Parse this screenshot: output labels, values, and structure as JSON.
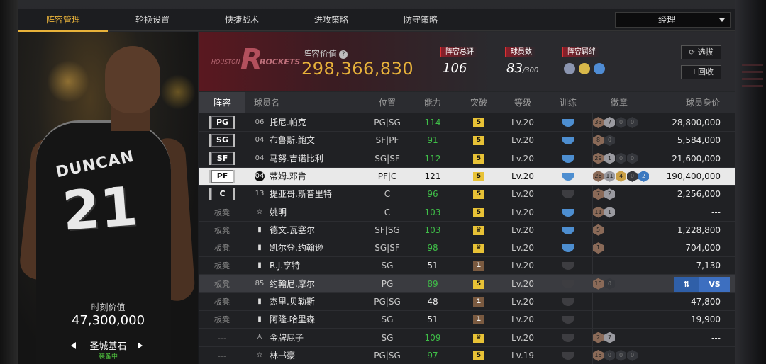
{
  "tabs": [
    "阵容管理",
    "轮换设置",
    "快捷战术",
    "进攻策略",
    "防守策略"
  ],
  "dropdown": {
    "value": "经理"
  },
  "portrait": {
    "jersey_name": "DUNCAN",
    "jersey_number": "21",
    "value_label": "时刻价值",
    "value": "47,300,000",
    "skin": "圣城基石",
    "status": "装备中"
  },
  "summary": {
    "team_logo": {
      "left_text": "HOUSTON",
      "right_text": "ROCKETS",
      "mark": "R"
    },
    "lineup_value_label": "阵容价值",
    "lineup_value": "298,366,830",
    "rating_label": "阵容总评",
    "rating": "106",
    "players_label": "球员数",
    "players": "83",
    "players_max": "/300",
    "bond_label": "阵容羁绊",
    "btn_select": "选拔",
    "btn_recycle": "回收"
  },
  "headers": [
    "阵容",
    "球员名",
    "位置",
    "能力",
    "突破",
    "等级",
    "训练",
    "徽章",
    "球员身价"
  ],
  "swap": {
    "a": "⇅",
    "b": "VS"
  },
  "rows": [
    {
      "slot": "PG",
      "num": "06",
      "name": "托尼.帕克",
      "pos": "PG|SG",
      "ability": "114",
      "ab_green": true,
      "brk": "5",
      "brk_y": true,
      "level": "Lv.20",
      "train": "blue",
      "badges": [
        [
          "br",
          "33"
        ],
        [
          "sl",
          "7"
        ],
        [
          "dk",
          "0"
        ],
        [
          "dk",
          "0"
        ]
      ],
      "salary": "28,800,000"
    },
    {
      "slot": "SG",
      "num": "04",
      "name": "布鲁斯.鲍文",
      "pos": "SF|PF",
      "ability": "91",
      "ab_green": true,
      "brk": "5",
      "brk_y": true,
      "level": "Lv.20",
      "train": "blue",
      "badges": [
        [
          "br",
          "8"
        ],
        [
          "dk",
          "0"
        ]
      ],
      "salary": "5,584,000"
    },
    {
      "slot": "SF",
      "num": "04",
      "name": "马努.吉诺比利",
      "pos": "SG|SF",
      "ability": "112",
      "ab_green": true,
      "brk": "5",
      "brk_y": true,
      "level": "Lv.20",
      "train": "blue",
      "badges": [
        [
          "br",
          "29"
        ],
        [
          "sl",
          "1"
        ],
        [
          "dk",
          "0"
        ],
        [
          "dk",
          "0"
        ]
      ],
      "salary": "21,600,000"
    },
    {
      "slot": "PF",
      "num": "04",
      "name": "蒂姆.邓肯",
      "pos": "PF|C",
      "ability": "121",
      "ab_green": false,
      "brk": "5",
      "brk_y": true,
      "level": "Lv.20",
      "train": "blue",
      "badges": [
        [
          "br",
          "26"
        ],
        [
          "sl",
          "11"
        ],
        [
          "gd",
          "4"
        ],
        [
          "dk",
          "0"
        ],
        [
          "bl",
          "2"
        ]
      ],
      "salary": "190,400,000",
      "sel": true
    },
    {
      "slot": "C",
      "num": "13",
      "name": "提亚哥.斯普里特",
      "pos": "C",
      "ability": "96",
      "ab_green": true,
      "brk": "5",
      "brk_y": true,
      "level": "Lv.20",
      "train": "gray",
      "badges": [
        [
          "br",
          "7"
        ],
        [
          "sl",
          "2"
        ]
      ],
      "salary": "2,256,000"
    },
    {
      "slot": "板凳",
      "num": "☆",
      "name": "姚明",
      "pos": "C",
      "ability": "103",
      "ab_green": true,
      "brk": "5",
      "brk_y": true,
      "level": "Lv.20",
      "train": "blue",
      "badges": [
        [
          "br",
          "11"
        ],
        [
          "sl",
          "1"
        ]
      ],
      "salary": "---"
    },
    {
      "slot": "板凳",
      "num": "▮",
      "name": "德文.瓦塞尔",
      "pos": "SF|SG",
      "ability": "103",
      "ab_green": true,
      "brk": "♛",
      "brk_y": true,
      "level": "Lv.20",
      "train": "blue",
      "badges": [
        [
          "br",
          "5"
        ]
      ],
      "salary": "1,228,800"
    },
    {
      "slot": "板凳",
      "num": "▮",
      "name": "凯尔登.约翰逊",
      "pos": "SG|SF",
      "ability": "98",
      "ab_green": true,
      "brk": "♛",
      "brk_y": true,
      "level": "Lv.20",
      "train": "blue",
      "badges": [
        [
          "br",
          "1"
        ]
      ],
      "salary": "704,000"
    },
    {
      "slot": "板凳",
      "num": "▮",
      "name": "R.J.亨特",
      "pos": "SG",
      "ability": "51",
      "ab_green": false,
      "brk": "1",
      "brk_y": false,
      "level": "Lv.20",
      "train": "gray",
      "badges": [],
      "salary": "7,130"
    },
    {
      "slot": "板凳",
      "num": "85",
      "name": "约翰尼.摩尔",
      "pos": "PG",
      "ability": "89",
      "ab_green": true,
      "brk": "5",
      "brk_y": true,
      "level": "Lv.20",
      "train": "gray",
      "badges": [
        [
          "br",
          "15"
        ],
        [
          "dk",
          "0"
        ]
      ],
      "salary": "",
      "dim": true,
      "swap": true
    },
    {
      "slot": "板凳",
      "num": "▮",
      "name": "杰里.贝勒斯",
      "pos": "PG|SG",
      "ability": "48",
      "ab_green": false,
      "brk": "1",
      "brk_y": false,
      "level": "Lv.20",
      "train": "gray",
      "badges": [],
      "salary": "47,800"
    },
    {
      "slot": "板凳",
      "num": "▮",
      "name": "阿隆.哈里森",
      "pos": "SG",
      "ability": "51",
      "ab_green": false,
      "brk": "1",
      "brk_y": false,
      "level": "Lv.20",
      "train": "gray",
      "badges": [],
      "salary": "19,900"
    },
    {
      "slot": "---",
      "num": "♙",
      "name": "金牌屁子",
      "pos": "SG",
      "ability": "109",
      "ab_green": true,
      "brk": "♛",
      "brk_y": true,
      "level": "Lv.20",
      "train": "gray",
      "badges": [
        [
          "br",
          "2"
        ],
        [
          "sl",
          "7"
        ]
      ],
      "salary": "---"
    },
    {
      "slot": "---",
      "num": "☆",
      "name": "林书豪",
      "pos": "PG|SG",
      "ability": "97",
      "ab_green": true,
      "brk": "5",
      "brk_y": true,
      "level": "Lv.19",
      "train": "gray",
      "badges": [
        [
          "br",
          "15"
        ],
        [
          "dk",
          "0"
        ],
        [
          "dk",
          "0"
        ],
        [
          "dk",
          "0"
        ]
      ],
      "salary": "---"
    }
  ]
}
